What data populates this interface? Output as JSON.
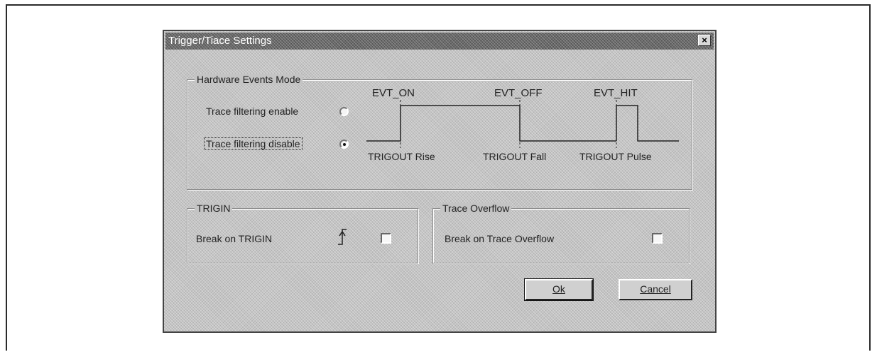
{
  "dialog": {
    "title": "Trigger/Tiace Settings",
    "close_glyph": "×"
  },
  "hardware_events": {
    "group_label": "Hardware Events Mode",
    "options": [
      {
        "label": "Trace filtering enable",
        "selected": false
      },
      {
        "label": "Trace filtering disable",
        "selected": true
      }
    ],
    "event_labels": {
      "evt_on": "EVT_ON",
      "evt_off": "EVT_OFF",
      "evt_hit": "EVT_HIT"
    },
    "trigout_labels": {
      "rise": "TRIGOUT Rise",
      "fall": "TRIGOUT Fall",
      "pulse": "TRIGOUT Pulse"
    }
  },
  "trigin": {
    "group_label": "TRIGIN",
    "checkbox_label": "Break on TRIGIN",
    "checked": false,
    "edge_icon": "rising-edge-icon"
  },
  "trace_overflow": {
    "group_label": "Trace Overflow",
    "checkbox_label": "Break on Trace Overflow",
    "checked": false
  },
  "buttons": {
    "ok_label": "Ok",
    "cancel_label": "Cancel"
  },
  "colors": {
    "dialog_bg": "#c4c4c4",
    "titlebar_bg": "#6a6a6a",
    "title_text": "#ffffff"
  }
}
